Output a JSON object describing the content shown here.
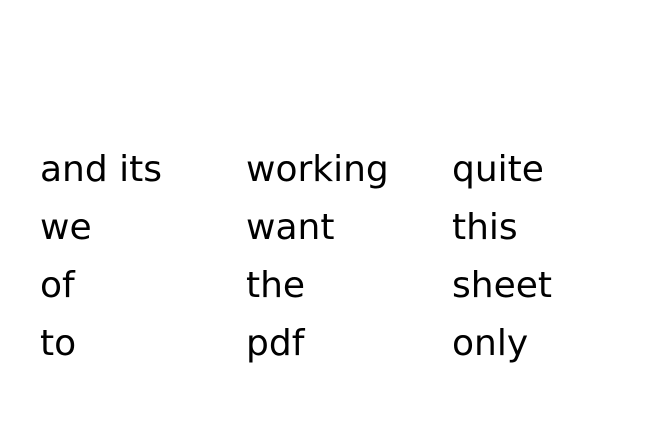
{
  "rows": [
    [
      "and its",
      "working",
      "quite"
    ],
    [
      "we",
      "want",
      "this"
    ],
    [
      "of",
      "the",
      "sheet"
    ],
    [
      "to",
      "pdf",
      "only"
    ]
  ]
}
